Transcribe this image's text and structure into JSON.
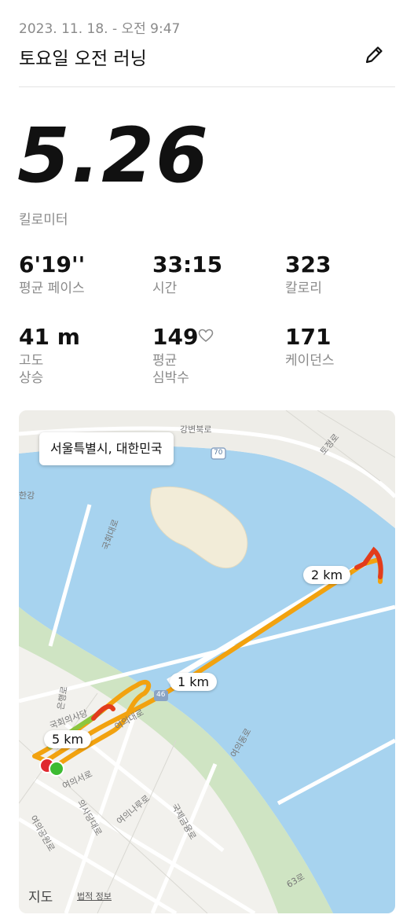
{
  "header": {
    "date": "2023. 11. 18. - 오전 9:47",
    "title": "토요일 오전 러닝",
    "edit_icon": "pencil-icon"
  },
  "distance": {
    "value": "5.26",
    "unit": "킬로미터"
  },
  "stats": {
    "pace": {
      "value": "6'19''",
      "label": "평균 페이스"
    },
    "time": {
      "value": "33:15",
      "label": "시간"
    },
    "calories": {
      "value": "323",
      "label": "칼로리"
    },
    "elevation": {
      "value": "41 m",
      "label_line1": "고도",
      "label_line2": "상승"
    },
    "heart_rate": {
      "value": "149",
      "label_line1": "평균",
      "label_line2": "심박수",
      "icon": "heart-icon"
    },
    "cadence": {
      "value": "171",
      "label": "케이던스"
    }
  },
  "map": {
    "location": "서울특별시, 대한민국",
    "km_labels": [
      "2 km",
      "1 km",
      "5 km"
    ],
    "provider": "지도",
    "legal": "법적 정보",
    "street_labels": [
      "강변북로",
      "70",
      "46",
      "한강",
      "국회대로",
      "여의대로",
      "여의동로",
      "63로",
      "토정로",
      "여의서로",
      "은행로",
      "국회의사당",
      "여의나루로",
      "국제금융로",
      "의사당대로",
      "여의공원로"
    ],
    "colors": {
      "water": "#a7d3ef",
      "route_main": "#f2a20f",
      "route_slow": "#e23c1c",
      "route_fast": "#8cc63f",
      "start": "#3dbb32",
      "end": "#e0292f"
    }
  }
}
